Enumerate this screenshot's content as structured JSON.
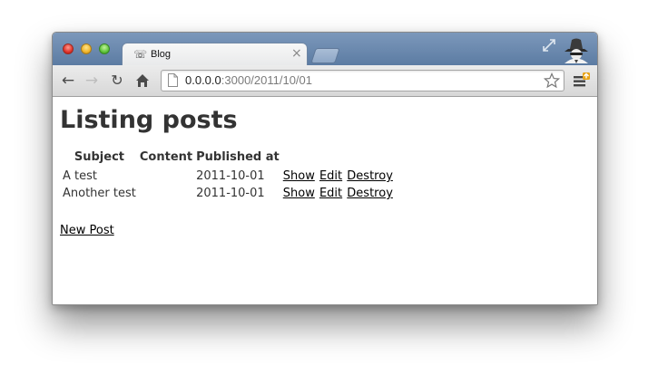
{
  "browser": {
    "tab_title": "Blog",
    "url_host": "0.0.0.0",
    "url_path": ":3000/2011/10/01",
    "tab_close_glyph": "×",
    "icons": [
      "close-tab-icon",
      "back-icon",
      "forward-icon",
      "reload-icon",
      "home-icon",
      "page-icon",
      "star-icon",
      "wrench-icon",
      "fullscreen-icon",
      "incognito-icon"
    ],
    "colors": {
      "titlebar": "#6a88ad",
      "toolbar": "#e2e2e2",
      "link": "#000000",
      "text": "#333333"
    }
  },
  "page": {
    "title": "Listing posts",
    "table": {
      "headers": [
        "Subject",
        "Content",
        "Published at"
      ],
      "rows": [
        {
          "subject": "A test",
          "content": "",
          "published": "2011-10-01",
          "show": "Show",
          "edit": "Edit",
          "destroy": "Destroy"
        },
        {
          "subject": "Another test",
          "content": "",
          "published": "2011-10-01",
          "show": "Show",
          "edit": "Edit",
          "destroy": "Destroy"
        }
      ]
    },
    "new_link": "New Post"
  }
}
